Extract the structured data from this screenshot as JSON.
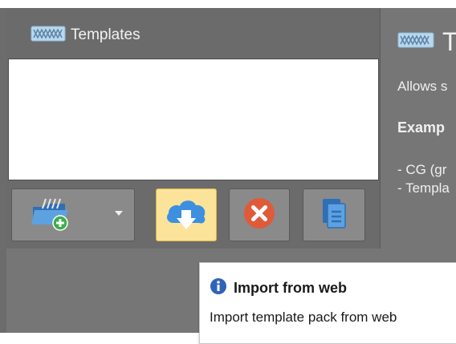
{
  "panel": {
    "title": "Templates",
    "icon": "template-grid-icon"
  },
  "toolbar": {
    "add_icon": "folder-add-icon",
    "dropdown_icon": "caret-down-icon",
    "import_icon": "cloud-download-icon",
    "remove_icon": "close-circle-icon",
    "copy_icon": "copy-document-icon",
    "colors": {
      "import_bg": "#fbe39a",
      "remove_red": "#e05a3a",
      "cloud_blue": "#3d8fe0"
    }
  },
  "details": {
    "title": "T",
    "line1": "Allows s",
    "line2": "Examp",
    "line3": "- CG (gr",
    "line4": "- Templa"
  },
  "tooltip": {
    "title": "Import from web",
    "description": "Import template pack from web",
    "icon": "info-icon"
  }
}
